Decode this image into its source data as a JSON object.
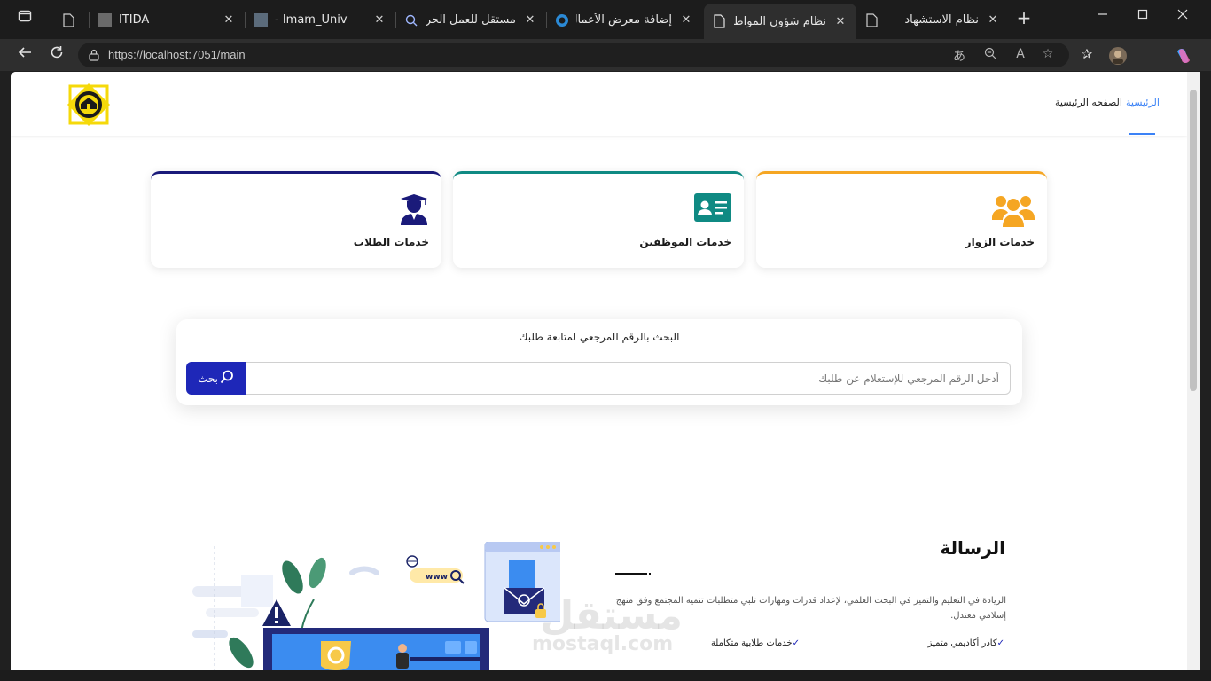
{
  "browser": {
    "tabs": [
      {
        "title": "",
        "icon": "page-icon"
      },
      {
        "title": "ITIDA",
        "icon": "itida-favicon"
      },
      {
        "title": "- Imam_Univ",
        "icon": "book-favicon"
      },
      {
        "title": "مستقل للعمل الحر - h",
        "icon": "search-favicon"
      },
      {
        "title": "إضافة معرض الأعمال",
        "icon": "mostaql-favicon"
      },
      {
        "title": "نظام شؤون المواطنين",
        "icon": "page-icon",
        "active": true
      },
      {
        "title": "نظام الاستشهاد",
        "icon": "page-icon"
      }
    ],
    "close_glyph": "✕",
    "new_tab_glyph": "+",
    "url": "https://localhost:7051/main"
  },
  "header": {
    "logo_icon": "university-emblem-icon",
    "nav": {
      "home_active": "الرئيسية",
      "home_page": "الصفحه الرئيسية"
    },
    "accent": "#3b82f6"
  },
  "services": [
    {
      "label": "خدمات الطلاب",
      "icon": "graduate-icon",
      "color": "#1a1a7a"
    },
    {
      "label": "خدمات الموظفين",
      "icon": "id-card-icon",
      "color": "#0f8a83"
    },
    {
      "label": "خدمات الزوار",
      "icon": "users-icon",
      "color": "#f5a623"
    }
  ],
  "search": {
    "title": "البحث بالرقم المرجعي لمتابعة طلبك",
    "placeholder": "أدخل الرقم المرجعي للإستعلام عن طلبك",
    "value": "",
    "button_label": "بحث",
    "button_color": "#1e27b8"
  },
  "mission": {
    "title": "الرسالة",
    "text": "الريادة في التعليم والتميز في البحث العلمي، لإعداد قدرات ومهارات تلبي متطلبات تنمية المجتمع وفق منهج إسلامي معتدل.",
    "features": [
      "كادر أكاديمي متميز",
      "خدمات طلابية متكاملة"
    ]
  },
  "illustration": {
    "url_badge": "www"
  },
  "watermark": {
    "arabic": "مستقل",
    "latin": "mostaql.com"
  }
}
